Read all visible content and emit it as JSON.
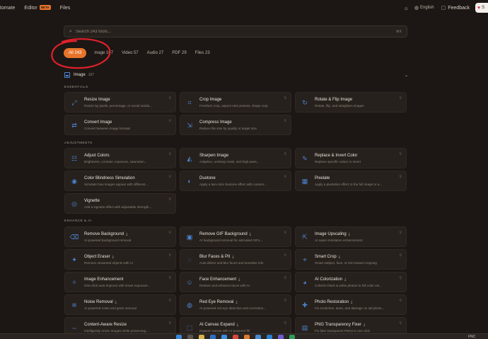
{
  "nav": {
    "items": [
      {
        "label": "tomate"
      },
      {
        "label": "Editor",
        "badge": "BETA"
      },
      {
        "label": "Files"
      }
    ],
    "language": "English",
    "feedback": "Feedback",
    "sponsor": "S"
  },
  "search": {
    "placeholder": "Search 243 tools...",
    "shortcut": "⌘K"
  },
  "tabs": [
    {
      "label": "All 243",
      "active": true
    },
    {
      "label": "mage 107"
    },
    {
      "label": "Video 57"
    },
    {
      "label": "Audio 27"
    },
    {
      "label": "PDF 29"
    },
    {
      "label": "Files 23"
    }
  ],
  "section": {
    "title": "Image",
    "count": "107"
  },
  "categories": {
    "essentials": "ESSENTIALS",
    "adjustments": "ADJUSTMENTS",
    "enhance": "ENHANCE & AI"
  },
  "cards": [
    {
      "title": "Resize Image",
      "desc": "Resize by pixels, percentage, or social media...",
      "icon": "resize-icon"
    },
    {
      "title": "Crop Image",
      "desc": "Freeform crop, aspect ratio presets, shape crop",
      "icon": "crop-icon"
    },
    {
      "title": "Rotate & Flip Image",
      "desc": "Rotate, flip, and straighten images",
      "icon": "rotate-icon"
    },
    {
      "title": "Convert Image",
      "desc": "Convert between image formats",
      "icon": "convert-icon"
    },
    {
      "title": "Compress Image",
      "desc": "Reduce file size by quality or target size",
      "icon": "compress-icon"
    },
    {
      "title": "Adjust Colors",
      "desc": "Brightness, contrast, exposure, saturation...",
      "icon": "sliders-icon"
    },
    {
      "title": "Sharpen Image",
      "desc": "Adaptive, unsharp mask, and high-pass...",
      "icon": "sharpen-icon"
    },
    {
      "title": "Replace & Invert Color",
      "desc": "Replace specific colors or invert",
      "icon": "eyedropper-icon"
    },
    {
      "title": "Color Blindness Simulation",
      "desc": "Simulate how images appear with different...",
      "icon": "eye-icon"
    },
    {
      "title": "Duotone",
      "desc": "Apply a two-color duotone effect with custom...",
      "icon": "palette-icon"
    },
    {
      "title": "Pixelate",
      "desc": "Apply a pixelation effect to the full image or a...",
      "icon": "grid-icon"
    },
    {
      "title": "Vignette",
      "desc": "Add a vignette effect with adjustable strength...",
      "icon": "vignette-icon"
    },
    {
      "title": "Remove Background",
      "ai": "⤓",
      "desc": "AI-powered background removal",
      "icon": "eraser-icon"
    },
    {
      "title": "Remove GIF Background",
      "ai": "⤓",
      "desc": "AI background removal for animated GIFs...",
      "icon": "film-icon"
    },
    {
      "title": "Image Upscaling",
      "ai": "⤓",
      "desc": "AI super-resolution enhancement",
      "icon": "upscale-icon"
    },
    {
      "title": "Object Eraser",
      "ai": "⤓",
      "desc": "Remove unwanted objects with AI",
      "icon": "wand-icon"
    },
    {
      "title": "Blur Faces & PII",
      "ai": "⤓",
      "desc": "Auto-detect and blur faces and sensitive info",
      "icon": "blur-icon"
    },
    {
      "title": "Smart Crop",
      "ai": "⤓",
      "desc": "Smart subject, face, or trim-based cropping",
      "icon": "smart-crop-icon"
    },
    {
      "title": "Image Enhancement",
      "desc": "One-click auto-improve with smart exposure...",
      "icon": "sparkle-icon"
    },
    {
      "title": "Face Enhancement",
      "ai": "⤓",
      "desc": "Restore and enhance faces with AI",
      "icon": "face-icon"
    },
    {
      "title": "AI Colorization",
      "ai": "⤓",
      "desc": "Colorize black & white photos to full color usi...",
      "icon": "colorize-icon"
    },
    {
      "title": "Noise Removal",
      "ai": "⤓",
      "desc": "AI-powered noise and grain removal",
      "icon": "noise-icon"
    },
    {
      "title": "Red Eye Removal",
      "ai": "⤓",
      "desc": "AI-powered red eye detection and correction...",
      "icon": "red-eye-icon"
    },
    {
      "title": "Photo Restoration",
      "ai": "⤓",
      "desc": "Fix scratches, tears, and damage on old photo...",
      "icon": "restore-icon"
    },
    {
      "title": "Content-Aware Resize",
      "desc": "Intelligently resize images while preserving...",
      "icon": "content-resize-icon"
    },
    {
      "title": "AI Canvas Expand",
      "ai": "⤓",
      "desc": "Expand canvas with AI-powered fill",
      "icon": "expand-icon"
    },
    {
      "title": "PNG Transparency Fixer",
      "ai": "⤓",
      "desc": "Fix fake transparent PNGs in one click",
      "icon": "transparency-icon"
    }
  ],
  "taskbar": {
    "weather": "FNC"
  },
  "colors": {
    "accent": "#e8742c",
    "icon": "#4b86d6",
    "annotation": "#e0202a",
    "background": "#1c1714",
    "card": "#27211d"
  }
}
